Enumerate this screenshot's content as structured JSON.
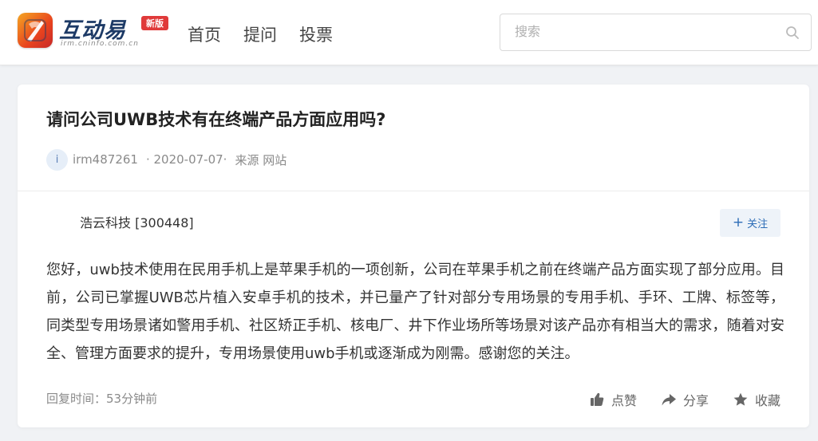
{
  "header": {
    "logo": {
      "text": "互动易",
      "subtext": "irm.cninfo.com.cn",
      "badge": "新版"
    },
    "nav": [
      {
        "label": "首页"
      },
      {
        "label": "提问"
      },
      {
        "label": "投票"
      }
    ],
    "search": {
      "placeholder": "搜索"
    }
  },
  "question": {
    "title": "请问公司UWB技术有在终端产品方面应用吗?",
    "avatar_letter": "i",
    "user": "irm487261",
    "date": "· 2020-07-07·",
    "source": "来源 网站"
  },
  "answer": {
    "company": "浩云科技 [300448]",
    "follow_label": "关注",
    "text": "您好，uwb技术使用在民用手机上是苹果手机的一项创新，公司在苹果手机之前在终端产品方面实现了部分应用。目前，公司已掌握UWB芯片植入安卓手机的技术，并已量产了针对部分专用场景的专用手机、手环、工牌、标签等，同类型专用场景诸如警用手机、社区矫正手机、核电厂、井下作业场所等场景对该产品亦有相当大的需求，随着对安全、管理方面要求的提升，专用场景使用uwb手机或逐渐成为刚需。感谢您的关注。",
    "reply_time": "回复时间：53分钟前",
    "actions": {
      "like": "点赞",
      "share": "分享",
      "favorite": "收藏"
    }
  },
  "colors": {
    "accent": "#2d6db7",
    "badge": "#e03a3a",
    "background": "#f0f2f5",
    "logo_text": "#1d3a66"
  }
}
